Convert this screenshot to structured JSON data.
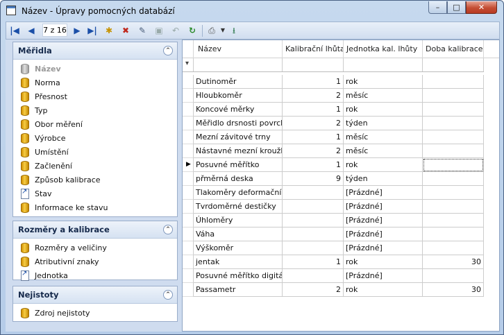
{
  "window": {
    "title": "Název - Úpravy pomocných databází",
    "buttons": {
      "minimize": "–",
      "maximize": "□",
      "close": "✕"
    }
  },
  "toolbar": {
    "position_text": "7 z 16",
    "buttons": [
      {
        "name": "first-record-icon",
        "glyph": "|◀"
      },
      {
        "name": "prev-record-icon",
        "glyph": "◀"
      },
      {
        "name": "next-record-icon",
        "glyph": "▶"
      },
      {
        "name": "last-record-icon",
        "glyph": "▶|"
      },
      {
        "name": "new-record-icon",
        "glyph": "✱"
      },
      {
        "name": "delete-record-icon",
        "glyph": "✖"
      },
      {
        "name": "edit-record-icon",
        "glyph": "✎"
      },
      {
        "name": "save-record-icon",
        "glyph": "▣"
      },
      {
        "name": "undo-icon",
        "glyph": "↶"
      },
      {
        "name": "refresh-icon",
        "glyph": "↻"
      },
      {
        "name": "print-icon",
        "glyph": "⎙"
      },
      {
        "name": "export-excel-icon",
        "glyph": "⭳"
      }
    ]
  },
  "sidebar": {
    "panels": [
      {
        "title": "Měřidla",
        "items": [
          {
            "label": "Název",
            "icon": "database-icon",
            "disabled": true
          },
          {
            "label": "Norma",
            "icon": "database-icon"
          },
          {
            "label": "Přesnost",
            "icon": "database-icon"
          },
          {
            "label": "Typ",
            "icon": "database-icon"
          },
          {
            "label": "Obor měření",
            "icon": "database-icon"
          },
          {
            "label": "Výrobce",
            "icon": "database-icon"
          },
          {
            "label": "Umístění",
            "icon": "database-icon"
          },
          {
            "label": "Začlenění",
            "icon": "database-icon"
          },
          {
            "label": "Způsob kalibrace",
            "icon": "database-icon"
          },
          {
            "label": "Stav",
            "icon": "shortcut-icon"
          },
          {
            "label": "Informace ke stavu",
            "icon": "database-icon"
          }
        ]
      },
      {
        "title": "Rozměry a kalibrace",
        "items": [
          {
            "label": "Rozměry a veličiny",
            "icon": "database-icon"
          },
          {
            "label": "Atributivní znaky",
            "icon": "database-icon"
          },
          {
            "label": "Jednotka",
            "icon": "shortcut-icon"
          }
        ]
      },
      {
        "title": "Nejistoty",
        "items": [
          {
            "label": "Zdroj nejistoty",
            "icon": "database-icon"
          }
        ]
      }
    ]
  },
  "grid": {
    "columns": [
      "Název",
      "Kalibrační lhůta",
      "Jednotka kal. lhůty",
      "Doba kalibrace"
    ],
    "current_row": 6,
    "rows": [
      [
        "Dutinoměr",
        "1",
        "rok",
        ""
      ],
      [
        "Hloubkoměr",
        "2",
        "měsíc",
        ""
      ],
      [
        "Koncové měrky",
        "1",
        "rok",
        ""
      ],
      [
        "Měřidlo drsnosti povrchu",
        "2",
        "týden",
        ""
      ],
      [
        "Mezní závitové trny",
        "1",
        "měsíc",
        ""
      ],
      [
        "Nástavné mezní kroužky",
        "2",
        "měsíc",
        ""
      ],
      [
        "Posuvné měřítko",
        "1",
        "rok",
        ""
      ],
      [
        "přměrná deska",
        "9",
        "týden",
        ""
      ],
      [
        "Tlakoměry deformační",
        "",
        "[Prázdné]",
        ""
      ],
      [
        "Tvrdoměrné destičky",
        "",
        "[Prázdné]",
        ""
      ],
      [
        "Úhloměry",
        "",
        "[Prázdné]",
        ""
      ],
      [
        "Váha",
        "",
        "[Prázdné]",
        ""
      ],
      [
        "Výškoměr",
        "",
        "[Prázdné]",
        ""
      ],
      [
        "jentak",
        "1",
        "rok",
        "30"
      ],
      [
        "Posuvné měřítko digitální",
        "",
        "[Prázdné]",
        ""
      ],
      [
        "Passametr",
        "2",
        "rok",
        "30"
      ]
    ]
  }
}
